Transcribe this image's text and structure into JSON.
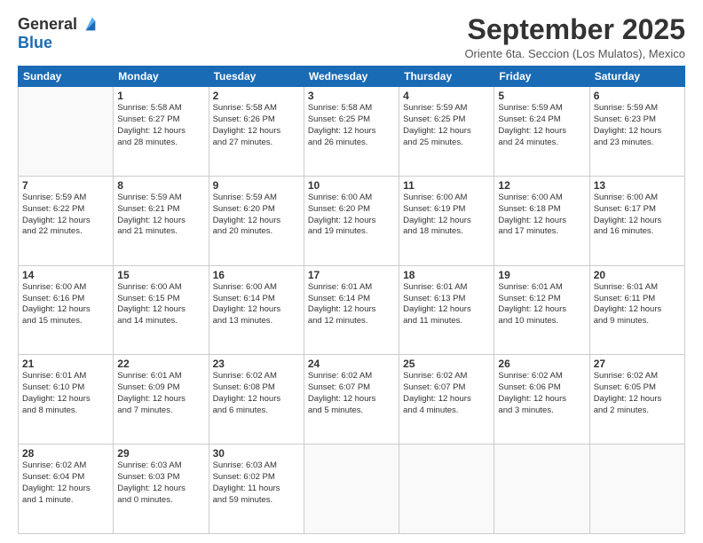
{
  "logo": {
    "general": "General",
    "blue": "Blue"
  },
  "header": {
    "month": "September 2025",
    "location": "Oriente 6ta. Seccion (Los Mulatos), Mexico"
  },
  "days_of_week": [
    "Sunday",
    "Monday",
    "Tuesday",
    "Wednesday",
    "Thursday",
    "Friday",
    "Saturday"
  ],
  "weeks": [
    [
      {
        "day": "",
        "info": ""
      },
      {
        "day": "1",
        "info": "Sunrise: 5:58 AM\nSunset: 6:27 PM\nDaylight: 12 hours\nand 28 minutes."
      },
      {
        "day": "2",
        "info": "Sunrise: 5:58 AM\nSunset: 6:26 PM\nDaylight: 12 hours\nand 27 minutes."
      },
      {
        "day": "3",
        "info": "Sunrise: 5:58 AM\nSunset: 6:25 PM\nDaylight: 12 hours\nand 26 minutes."
      },
      {
        "day": "4",
        "info": "Sunrise: 5:59 AM\nSunset: 6:25 PM\nDaylight: 12 hours\nand 25 minutes."
      },
      {
        "day": "5",
        "info": "Sunrise: 5:59 AM\nSunset: 6:24 PM\nDaylight: 12 hours\nand 24 minutes."
      },
      {
        "day": "6",
        "info": "Sunrise: 5:59 AM\nSunset: 6:23 PM\nDaylight: 12 hours\nand 23 minutes."
      }
    ],
    [
      {
        "day": "7",
        "info": "Sunrise: 5:59 AM\nSunset: 6:22 PM\nDaylight: 12 hours\nand 22 minutes."
      },
      {
        "day": "8",
        "info": "Sunrise: 5:59 AM\nSunset: 6:21 PM\nDaylight: 12 hours\nand 21 minutes."
      },
      {
        "day": "9",
        "info": "Sunrise: 5:59 AM\nSunset: 6:20 PM\nDaylight: 12 hours\nand 20 minutes."
      },
      {
        "day": "10",
        "info": "Sunrise: 6:00 AM\nSunset: 6:20 PM\nDaylight: 12 hours\nand 19 minutes."
      },
      {
        "day": "11",
        "info": "Sunrise: 6:00 AM\nSunset: 6:19 PM\nDaylight: 12 hours\nand 18 minutes."
      },
      {
        "day": "12",
        "info": "Sunrise: 6:00 AM\nSunset: 6:18 PM\nDaylight: 12 hours\nand 17 minutes."
      },
      {
        "day": "13",
        "info": "Sunrise: 6:00 AM\nSunset: 6:17 PM\nDaylight: 12 hours\nand 16 minutes."
      }
    ],
    [
      {
        "day": "14",
        "info": "Sunrise: 6:00 AM\nSunset: 6:16 PM\nDaylight: 12 hours\nand 15 minutes."
      },
      {
        "day": "15",
        "info": "Sunrise: 6:00 AM\nSunset: 6:15 PM\nDaylight: 12 hours\nand 14 minutes."
      },
      {
        "day": "16",
        "info": "Sunrise: 6:00 AM\nSunset: 6:14 PM\nDaylight: 12 hours\nand 13 minutes."
      },
      {
        "day": "17",
        "info": "Sunrise: 6:01 AM\nSunset: 6:14 PM\nDaylight: 12 hours\nand 12 minutes."
      },
      {
        "day": "18",
        "info": "Sunrise: 6:01 AM\nSunset: 6:13 PM\nDaylight: 12 hours\nand 11 minutes."
      },
      {
        "day": "19",
        "info": "Sunrise: 6:01 AM\nSunset: 6:12 PM\nDaylight: 12 hours\nand 10 minutes."
      },
      {
        "day": "20",
        "info": "Sunrise: 6:01 AM\nSunset: 6:11 PM\nDaylight: 12 hours\nand 9 minutes."
      }
    ],
    [
      {
        "day": "21",
        "info": "Sunrise: 6:01 AM\nSunset: 6:10 PM\nDaylight: 12 hours\nand 8 minutes."
      },
      {
        "day": "22",
        "info": "Sunrise: 6:01 AM\nSunset: 6:09 PM\nDaylight: 12 hours\nand 7 minutes."
      },
      {
        "day": "23",
        "info": "Sunrise: 6:02 AM\nSunset: 6:08 PM\nDaylight: 12 hours\nand 6 minutes."
      },
      {
        "day": "24",
        "info": "Sunrise: 6:02 AM\nSunset: 6:07 PM\nDaylight: 12 hours\nand 5 minutes."
      },
      {
        "day": "25",
        "info": "Sunrise: 6:02 AM\nSunset: 6:07 PM\nDaylight: 12 hours\nand 4 minutes."
      },
      {
        "day": "26",
        "info": "Sunrise: 6:02 AM\nSunset: 6:06 PM\nDaylight: 12 hours\nand 3 minutes."
      },
      {
        "day": "27",
        "info": "Sunrise: 6:02 AM\nSunset: 6:05 PM\nDaylight: 12 hours\nand 2 minutes."
      }
    ],
    [
      {
        "day": "28",
        "info": "Sunrise: 6:02 AM\nSunset: 6:04 PM\nDaylight: 12 hours\nand 1 minute."
      },
      {
        "day": "29",
        "info": "Sunrise: 6:03 AM\nSunset: 6:03 PM\nDaylight: 12 hours\nand 0 minutes."
      },
      {
        "day": "30",
        "info": "Sunrise: 6:03 AM\nSunset: 6:02 PM\nDaylight: 11 hours\nand 59 minutes."
      },
      {
        "day": "",
        "info": ""
      },
      {
        "day": "",
        "info": ""
      },
      {
        "day": "",
        "info": ""
      },
      {
        "day": "",
        "info": ""
      }
    ]
  ]
}
